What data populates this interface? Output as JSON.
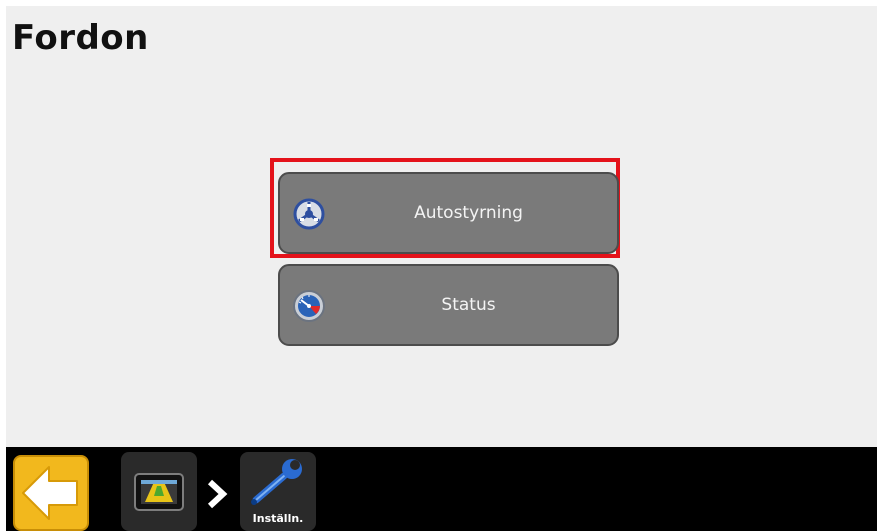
{
  "page": {
    "title": "Fordon"
  },
  "menu": {
    "items": [
      {
        "label": "Autostyrning",
        "icon": "steering-wheel-icon",
        "selected": true
      },
      {
        "label": "Status",
        "icon": "gauge-icon",
        "selected": false
      }
    ]
  },
  "bottom_bar": {
    "back_icon": "back-arrow-icon",
    "breadcrumbs": [
      {
        "icon": "display-icon",
        "label": ""
      },
      {
        "icon": "wrench-icon",
        "label": "Inställn."
      }
    ]
  },
  "colors": {
    "highlight": "#e4121a",
    "button": "#7a7a7a",
    "back_button": "#f2b81d",
    "bar": "#000000",
    "background": "#efefef"
  }
}
